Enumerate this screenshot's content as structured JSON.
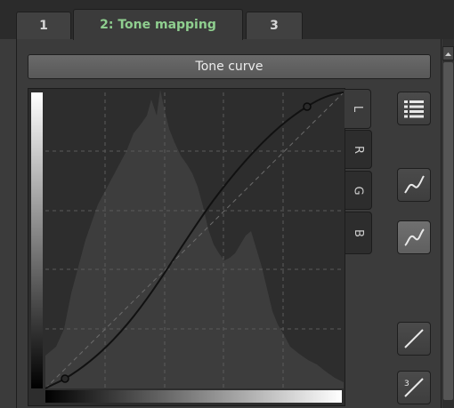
{
  "tabs": [
    {
      "label": "1"
    },
    {
      "label": "2: Tone mapping"
    },
    {
      "label": "3"
    }
  ],
  "panel": {
    "title": "Tone curve"
  },
  "channels": [
    {
      "label": "L"
    },
    {
      "label": "R"
    },
    {
      "label": "G"
    },
    {
      "label": "B"
    }
  ],
  "active_channel": "L",
  "side_buttons": [
    {
      "icon": "list-icon"
    },
    {
      "icon": "curve-smooth-icon"
    },
    {
      "icon": "curve-s-icon",
      "active": true
    },
    {
      "icon": "linear-icon"
    },
    {
      "icon": "cubic-linear-icon",
      "label": "3"
    }
  ],
  "curve": {
    "control_points": [
      [
        0.06,
        0.03
      ],
      [
        0.88,
        0.95
      ]
    ]
  },
  "colors": {
    "accent_tab_text": "#8fcf8f",
    "background": "#3b3b3b",
    "graph_background": "#2d2d2d"
  }
}
